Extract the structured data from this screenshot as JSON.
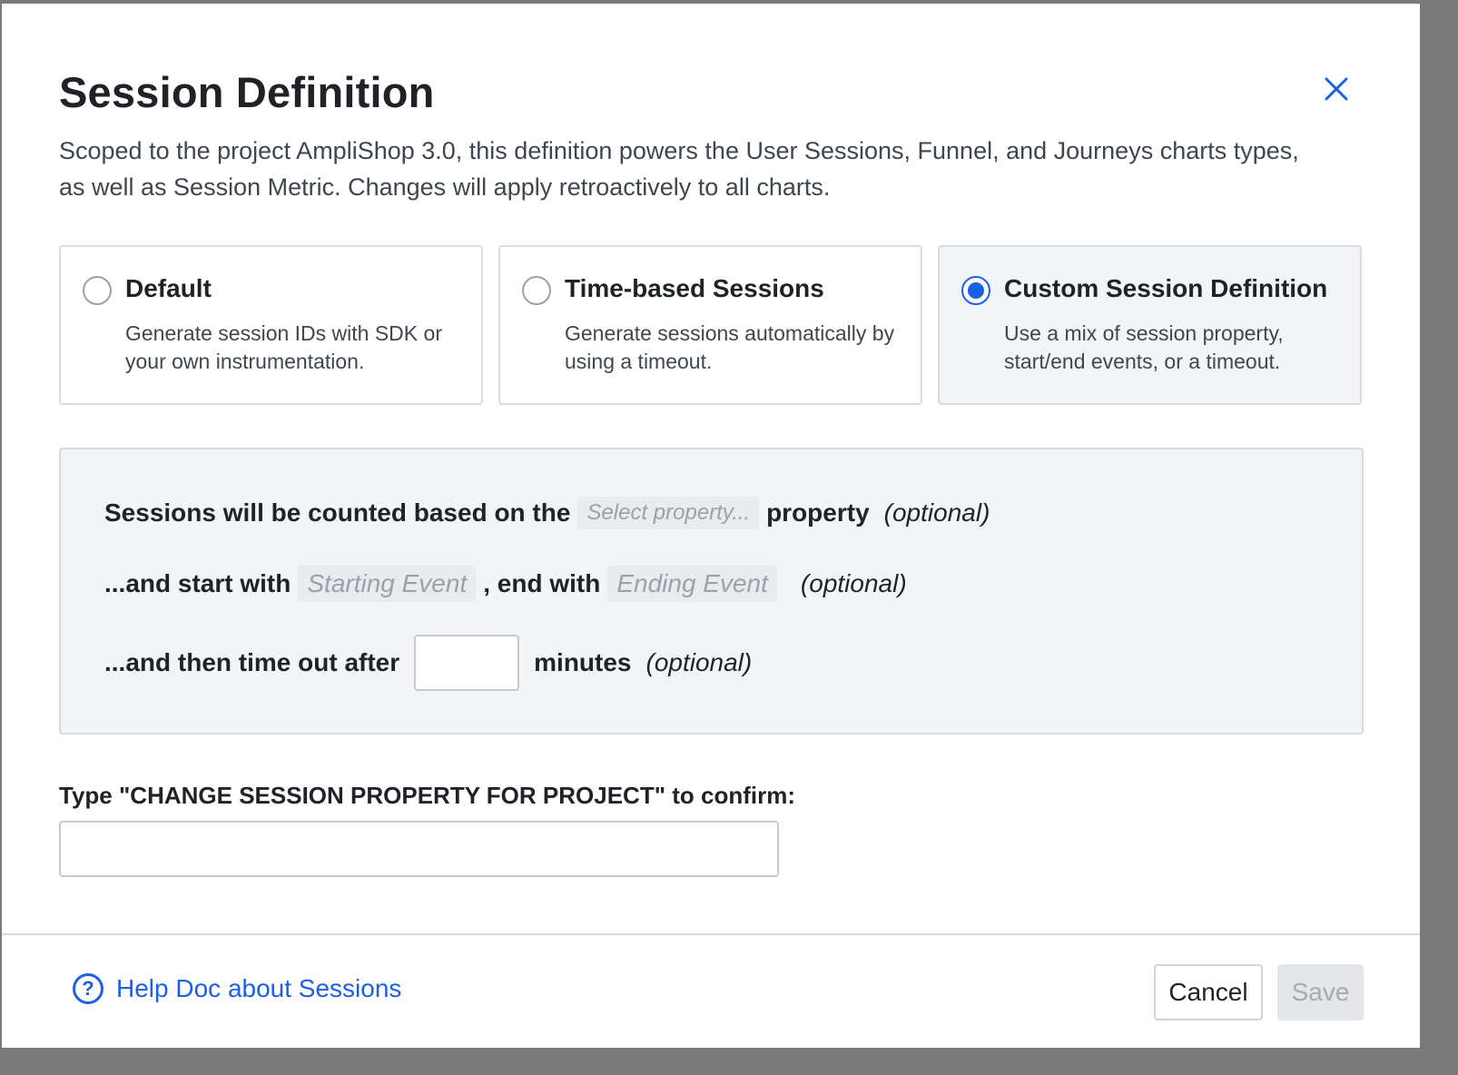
{
  "modal": {
    "title": "Session Definition",
    "description": "Scoped to the project AmpliShop 3.0, this definition powers the User Sessions, Funnel, and Journeys charts types, as well as Session Metric. Changes will apply retroactively to all charts."
  },
  "options": [
    {
      "title": "Default",
      "description": "Generate session IDs with SDK or your own instrumentation.",
      "selected": false
    },
    {
      "title": "Time-based Sessions",
      "description": "Generate sessions automatically by using a timeout.",
      "selected": false
    },
    {
      "title": "Custom Session Definition",
      "description": "Use a mix of session property, start/end events, or a timeout.",
      "selected": true
    }
  ],
  "config": {
    "row1_prefix": "Sessions will be counted based on the",
    "property_placeholder": "Select property...",
    "row1_suffix": "property",
    "optional": "(optional)",
    "row2_prefix": "...and start with",
    "start_placeholder": "Starting Event",
    "row2_mid": ", end with",
    "end_placeholder": "Ending Event",
    "row3_prefix": "...and then time out after",
    "timeout_value": "",
    "row3_suffix": "minutes"
  },
  "confirm": {
    "label": "Type \"CHANGE SESSION PROPERTY FOR PROJECT\" to confirm:",
    "value": ""
  },
  "footer": {
    "help_link": "Help Doc about Sessions",
    "cancel_label": "Cancel",
    "save_label": "Save",
    "save_enabled": false
  },
  "colors": {
    "accent": "#1a5fe6",
    "panel_bg": "#f3f4f6",
    "border": "#d8dbe0"
  }
}
